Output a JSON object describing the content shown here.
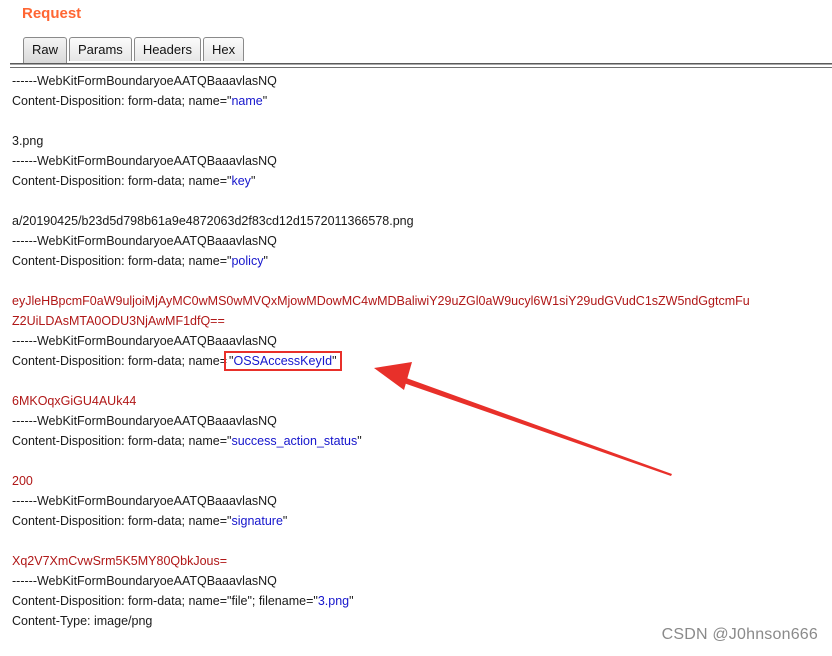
{
  "panel": {
    "title": "Request"
  },
  "tabs": [
    {
      "label": "Raw",
      "active": true
    },
    {
      "label": "Params",
      "active": false
    },
    {
      "label": "Headers",
      "active": false
    },
    {
      "label": "Hex",
      "active": false
    }
  ],
  "body": {
    "boundary": "------WebKitFormBoundaryoeAATQBaaavlasNQ",
    "cd_prefix": "Content-Disposition: form-data; name=",
    "field_name": "name",
    "value_name": "3.png",
    "field_key": "key",
    "value_key": "a/20190425/b23d5d798b61a9e4872063d2f83cd12d1572011366578.png",
    "field_policy": "policy",
    "value_policy_line1": "eyJleHBpcmF0aW9uljoiMjAyMC0wMS0wMVQxMjowMDowMC4wMDBaliwiY29uZGl0aW9ucyl6W1siY29udGVudC1sZW5ndGgtcmFu",
    "value_policy_line2": "Z2UiLDAsMTA0ODU3NjAwMF1dfQ==",
    "field_oss": "OSSAccessKeyId",
    "value_oss": "6MKOqxGiGU4AUk44",
    "field_success": "success_action_status",
    "value_success": "200",
    "field_signature": "signature",
    "value_signature": "Xq2V7XmCvwSrm5K5MY80QbkJous=",
    "file_prefix": "Content-Disposition: form-data; name=\"file\"; filename=",
    "file_name": "3.png",
    "content_type": "Content-Type: image/png"
  },
  "watermark": "CSDN @J0hnson666",
  "colors": {
    "title": "#ff6633",
    "value_red": "#b01717",
    "field_blue": "#1515cc",
    "annotation_red": "#e8302a"
  }
}
